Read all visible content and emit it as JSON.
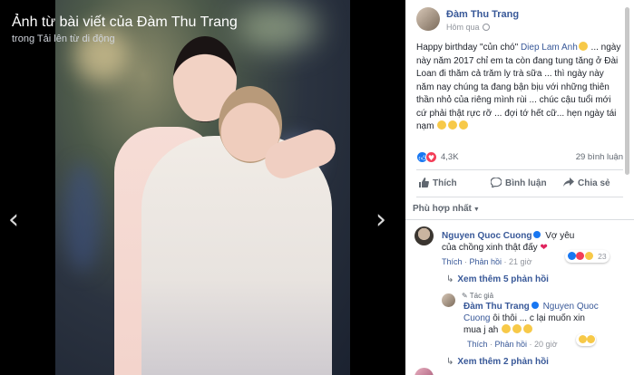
{
  "viewer": {
    "title": "Ảnh từ bài viết của Đàm Thu Trang",
    "subtitle": "trong Tải lên từ di động",
    "prev_icon": "chevron-left-icon",
    "next_icon": "chevron-right-icon"
  },
  "post": {
    "author": "Đàm Thu Trang",
    "time": "Hôm qua",
    "text_before_mention": "Happy birthday \"củn chó\" ",
    "mention": "Diep Lam Anh",
    "text_after_mention": " ... ngày này năm 2017 chỉ em ta còn đang tung tăng ở Đài Loan đi thăm cả trăm ly trà sữa ... thì ngày này năm nay chúng ta đang bận bịu với những thiên thần nhỏ của riêng mình rùi ... chúc cậu tuổi mới cứ phải thật rực rỡ ... đợi tớ hết cữ... hẹn ngày tái nạm",
    "reaction_count": "4,3K",
    "comment_count": "29 bình luận",
    "actions": {
      "like": "Thích",
      "comment": "Bình luận",
      "share": "Chia sẻ"
    },
    "sort_label": "Phù hợp nhất"
  },
  "comments": [
    {
      "name": "Nguyen Quoc Cuong",
      "text": "Vợ yêu của chồng xinh thật đấy",
      "like": "Thích",
      "reply": "Phản hồi",
      "time": "21 giờ",
      "reaction_count": "23",
      "more_replies": "Xem thêm 5 phản hồi"
    },
    {
      "author_tag": "Tác giả",
      "name": "Đàm Thu Trang",
      "mention": "Nguyen Quoc Cuong",
      "text": " ôi thôi ... c lại muốn xin mua j ah",
      "like": "Thích",
      "reply": "Phản hồi",
      "time": "20 giờ"
    }
  ],
  "more_replies_2": "Xem thêm 2 phản hồi",
  "colors": {
    "link": "#385898",
    "like_blue": "#1877f2",
    "love_red": "#f33e58"
  }
}
